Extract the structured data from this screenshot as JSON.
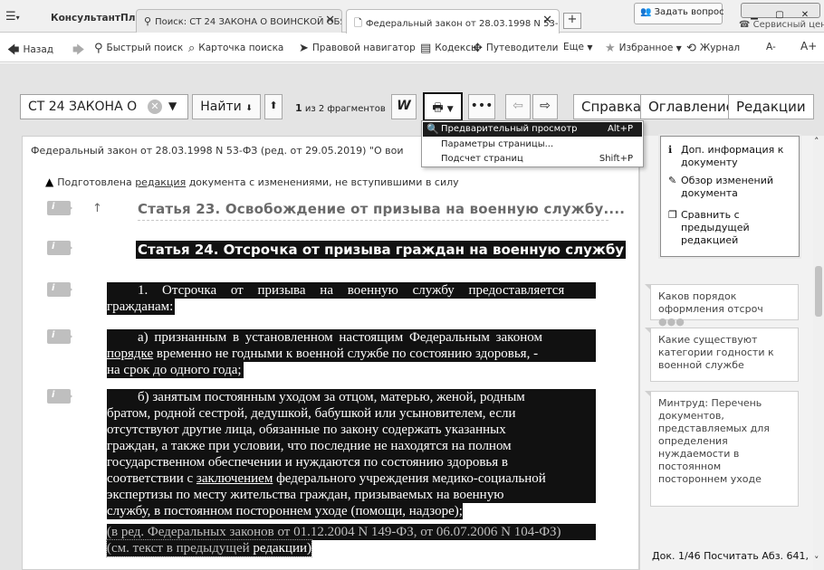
{
  "app": {
    "brand": "КонсультантПлюс",
    "ask_button": "Задать вопрос",
    "service_center": "Сервисный центр"
  },
  "tabs": [
    {
      "label": "Поиск: СТ 24 ЗАКОНА О ВОИНСКОЙ ОБЯЗ",
      "active": false
    },
    {
      "label": "Федеральный закон от 28.03.1998 N 53-ФЗ",
      "active": true
    }
  ],
  "toolbar": {
    "back": "Назад",
    "quick_search": "Быстрый поиск",
    "search_card": "Карточка поиска",
    "legal_navigator": "Правовой навигатор",
    "codes": "Кодексы",
    "guides": "Путеводители",
    "more": "Еще",
    "favorites": "Избранное",
    "journal": "Журнал",
    "font_smaller": "A-",
    "font_bigger": "A+"
  },
  "search": {
    "value": "СТ 24 ЗАКОНА О",
    "find_label": "Найти",
    "count_main": "1",
    "count_rest": "из 2 фрагментов"
  },
  "right_buttons": {
    "help": "Справка",
    "contents": "Оглавление",
    "editions": "Редакции"
  },
  "print_menu": [
    {
      "label": "Предварительный просмотр",
      "shortcut": "Alt+P",
      "highlighted": true
    },
    {
      "label": "Параметры страницы...",
      "shortcut": "",
      "highlighted": false
    },
    {
      "label": "Подсчет страниц",
      "shortcut": "Shift+P",
      "highlighted": false
    }
  ],
  "document": {
    "title": "Федеральный закон от 28.03.1998 N 53-ФЗ (ред. от 29.05.2019) \"О вои",
    "notice_prefix": "Подготовлена",
    "notice_link": "редакция",
    "notice_suffix": "документа с изменениями, не вступившими в силу",
    "prev_article": "Статья 23. Освобождение от призыва на военную службу....",
    "article_head": "Статья 24. Отсрочка от призыва граждан на военную службу",
    "p1_lines": [
      "1. Отсрочка от призыва на военную службу предоставляется",
      "гражданам:"
    ],
    "p2_lines": [
      "а) признанным в установленном настоящим Федеральным законом",
      "временно не годными к военной службе по состоянию здоровья, -",
      "на срок до одного года;"
    ],
    "p2_link": "порядке",
    "p3_lines": [
      "б) занятым постоянным уходом за отцом, матерью, женой, родным",
      "братом, родной сестрой, дедушкой, бабушкой или усыновителем, если",
      "отсутствуют другие лица, обязанные по закону содержать указанных",
      "граждан, а также при условии, что последние не находятся на полном",
      "государственном обеспечении и нуждаются по состоянию здоровья в",
      "федерального учреждения медико-социальной",
      "экспертизы по месту жительства граждан, призываемых на военную",
      "службу, в постоянном постороннем уходе (помощи, надзоре);"
    ],
    "p3_prefix": "соответствии с",
    "p3_link": "заключением",
    "edition_note": "(в ред. Федеральных законов от 01.12.2004 N 149-ФЗ, от 06.07.2006 N 104-ФЗ)",
    "prev_text_prefix": "(см. текст в предыдущей",
    "prev_text_link": "редакции)"
  },
  "side_panel": {
    "info_items": [
      {
        "icon": "info-icon",
        "label": "Доп. информация к документу"
      },
      {
        "icon": "changes-icon",
        "label": "Обзор изменений документа"
      },
      {
        "icon": "compare-icon",
        "label": "Сравнить с предыдущей редакцией"
      }
    ],
    "questions": [
      {
        "text": "Каков порядок оформления отсроч"
      },
      {
        "text": "Какие существуют категории годности к военной службе"
      },
      {
        "text": "Минтруд: Перечень документов, представляемых для определения нуждаемости в постоянном постороннем уходе"
      }
    ],
    "footer": "Док. 1/46 Посчитать Абз. 641,"
  }
}
